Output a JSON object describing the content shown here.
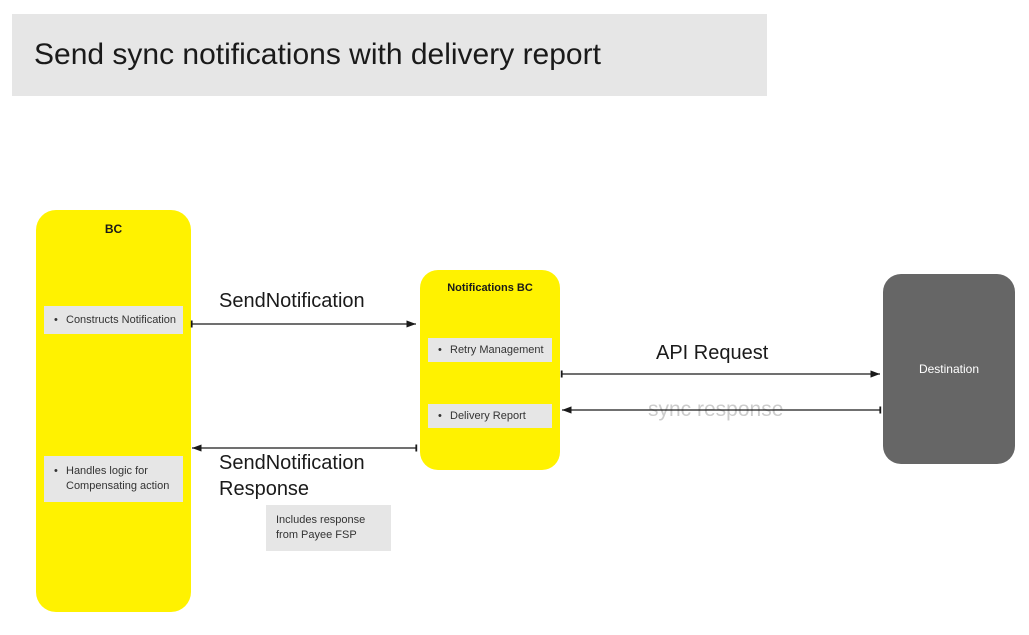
{
  "title": "Send sync notifications with delivery report",
  "bc": {
    "title": "BC",
    "item1": "Constructs Notification",
    "item2": "Handles logic for Compensating action"
  },
  "notifications": {
    "title": "Notifications BC",
    "item1": "Retry Management",
    "item2": "Delivery Report"
  },
  "destination": {
    "label": "Destination"
  },
  "arrows": {
    "send": "SendNotification",
    "api": "API  Request",
    "sync": "sync response",
    "response_line1": "SendNotification",
    "response_line2": "Response"
  },
  "note": "Includes response from Payee FSP"
}
